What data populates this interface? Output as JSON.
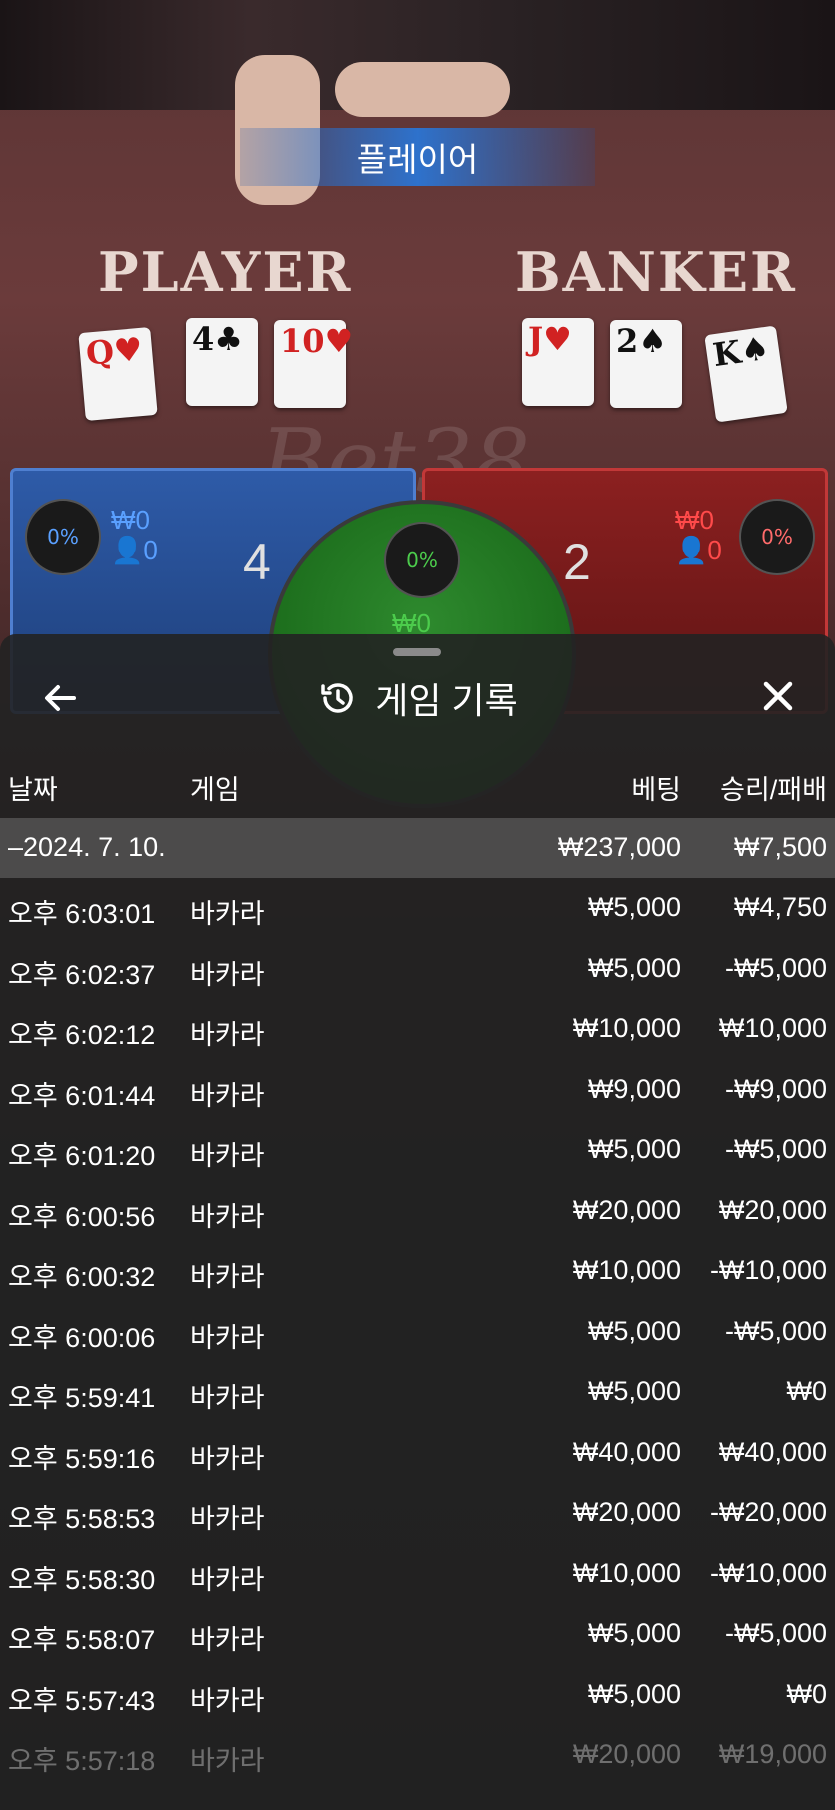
{
  "table": {
    "status_banner": "플레이어",
    "player_label": "PLAYER",
    "banker_label": "BANKER",
    "player_cards": [
      {
        "rank": "Q",
        "suit": "♥",
        "color": "red"
      },
      {
        "rank": "4",
        "suit": "♣",
        "color": "black"
      },
      {
        "rank": "10",
        "suit": "♥",
        "color": "red"
      }
    ],
    "banker_cards": [
      {
        "rank": "J",
        "suit": "♥",
        "color": "red"
      },
      {
        "rank": "2",
        "suit": "♠",
        "color": "black"
      },
      {
        "rank": "K",
        "suit": "♠",
        "color": "black"
      }
    ],
    "watermark": "Bet38",
    "player_panel": {
      "percent": "0%",
      "amount": "₩0",
      "count": "0",
      "score": "4"
    },
    "tie_panel": {
      "percent": "0%",
      "amount": "₩0"
    },
    "banker_panel": {
      "percent": "0%",
      "amount": "₩0",
      "count": "0",
      "score": "2"
    }
  },
  "sheet": {
    "title": "게임 기록",
    "back_icon": "arrow-left-icon",
    "close_icon": "close-icon",
    "history_icon": "history-icon",
    "columns": {
      "date": "날짜",
      "game": "게임",
      "bet": "베팅",
      "result": "승리/패배"
    },
    "summary": {
      "date": "–2024. 7. 10.",
      "bet": "₩237,000",
      "result": "₩7,500"
    },
    "rows": [
      {
        "date": "오후 6:03:01",
        "game": "바카라",
        "bet": "₩5,000",
        "result": "₩4,750"
      },
      {
        "date": "오후 6:02:37",
        "game": "바카라",
        "bet": "₩5,000",
        "result": "-₩5,000"
      },
      {
        "date": "오후 6:02:12",
        "game": "바카라",
        "bet": "₩10,000",
        "result": "₩10,000"
      },
      {
        "date": "오후 6:01:44",
        "game": "바카라",
        "bet": "₩9,000",
        "result": "-₩9,000"
      },
      {
        "date": "오후 6:01:20",
        "game": "바카라",
        "bet": "₩5,000",
        "result": "-₩5,000"
      },
      {
        "date": "오후 6:00:56",
        "game": "바카라",
        "bet": "₩20,000",
        "result": "₩20,000"
      },
      {
        "date": "오후 6:00:32",
        "game": "바카라",
        "bet": "₩10,000",
        "result": "-₩10,000"
      },
      {
        "date": "오후 6:00:06",
        "game": "바카라",
        "bet": "₩5,000",
        "result": "-₩5,000"
      },
      {
        "date": "오후 5:59:41",
        "game": "바카라",
        "bet": "₩5,000",
        "result": "₩0"
      },
      {
        "date": "오후 5:59:16",
        "game": "바카라",
        "bet": "₩40,000",
        "result": "₩40,000"
      },
      {
        "date": "오후 5:58:53",
        "game": "바카라",
        "bet": "₩20,000",
        "result": "-₩20,000"
      },
      {
        "date": "오후 5:58:30",
        "game": "바카라",
        "bet": "₩10,000",
        "result": "-₩10,000"
      },
      {
        "date": "오후 5:58:07",
        "game": "바카라",
        "bet": "₩5,000",
        "result": "-₩5,000"
      },
      {
        "date": "오후 5:57:43",
        "game": "바카라",
        "bet": "₩5,000",
        "result": "₩0"
      },
      {
        "date": "오후 5:57:18",
        "game": "바카라",
        "bet": "₩20,000",
        "result": "₩19,000"
      }
    ]
  },
  "colors": {
    "player_blue": "#2e5ba8",
    "banker_red": "#8c2020",
    "tie_green": "#2e8a2e"
  }
}
